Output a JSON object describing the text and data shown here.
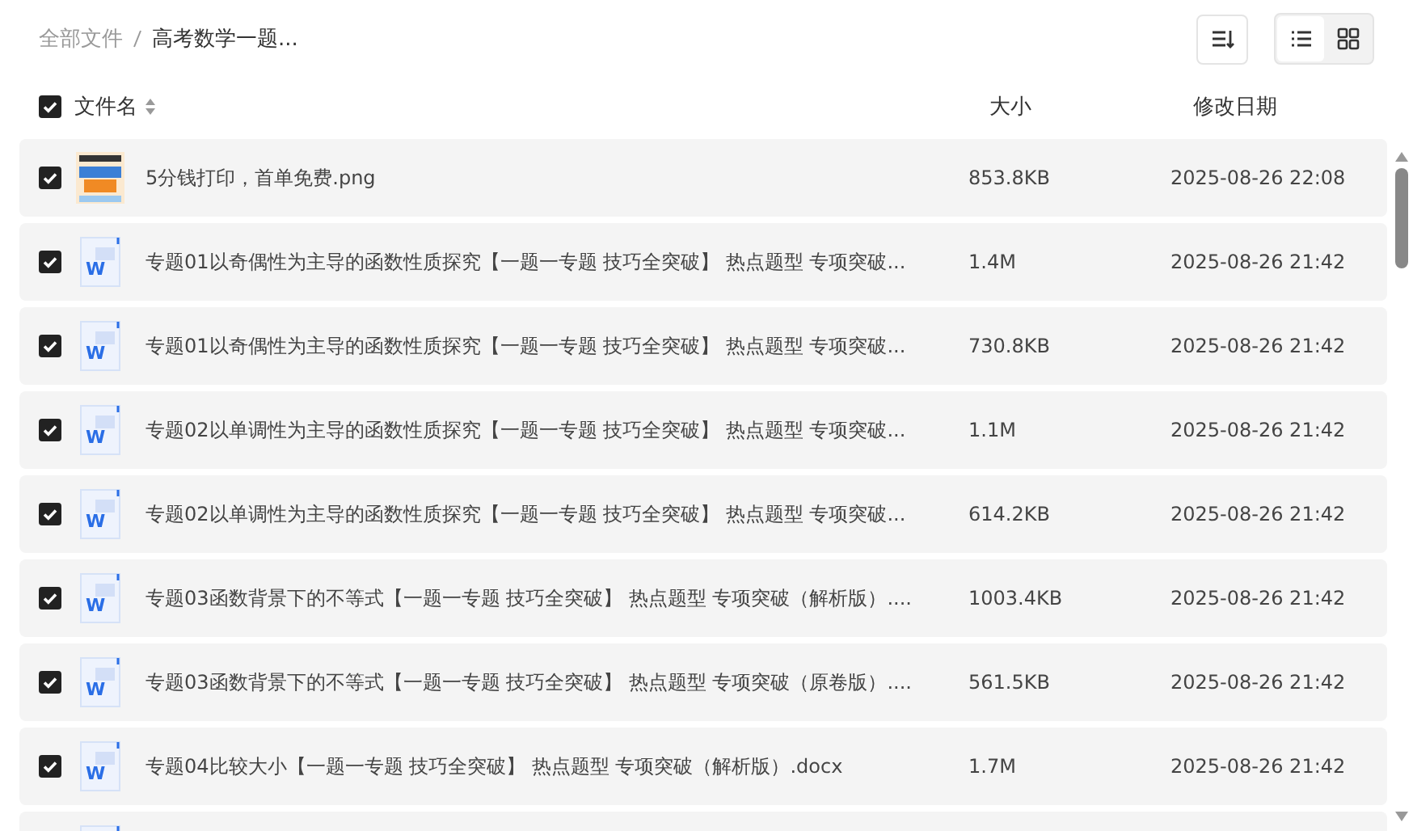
{
  "breadcrumb": [
    {
      "label": "全部文件",
      "current": false
    },
    {
      "label": "高考数学一题...",
      "current": true
    }
  ],
  "view_modes": [
    {
      "kind": "list",
      "selected": true
    },
    {
      "kind": "grid",
      "selected": false
    }
  ],
  "table": {
    "all_checked": true,
    "columns": [
      "文件名",
      "大小",
      "修改日期"
    ],
    "rows": [
      {
        "kind": "image",
        "checked": true,
        "name": "5分钱打印，首单免费.png",
        "size": "853.8KB",
        "modified": "2025-08-26 22:08"
      },
      {
        "kind": "doc",
        "checked": true,
        "icon_letter": "W",
        "name": "专题01以奇偶性为主导的函数性质探究【一题一专题 技巧全突破】 热点题型 专项突破...",
        "size": "1.4M",
        "modified": "2025-08-26 21:42"
      },
      {
        "kind": "doc",
        "checked": true,
        "icon_letter": "W",
        "name": "专题01以奇偶性为主导的函数性质探究【一题一专题 技巧全突破】 热点题型 专项突破...",
        "size": "730.8KB",
        "modified": "2025-08-26 21:42"
      },
      {
        "kind": "doc",
        "checked": true,
        "icon_letter": "W",
        "name": "专题02以单调性为主导的函数性质探究【一题一专题 技巧全突破】 热点题型 专项突破...",
        "size": "1.1M",
        "modified": "2025-08-26 21:42"
      },
      {
        "kind": "doc",
        "checked": true,
        "icon_letter": "W",
        "name": "专题02以单调性为主导的函数性质探究【一题一专题 技巧全突破】 热点题型 专项突破...",
        "size": "614.2KB",
        "modified": "2025-08-26 21:42"
      },
      {
        "kind": "doc",
        "checked": true,
        "icon_letter": "W",
        "name": "专题03函数背景下的不等式【一题一专题 技巧全突破】 热点题型 专项突破（解析版）....",
        "size": "1003.4KB",
        "modified": "2025-08-26 21:42"
      },
      {
        "kind": "doc",
        "checked": true,
        "icon_letter": "W",
        "name": "专题03函数背景下的不等式【一题一专题 技巧全突破】 热点题型 专项突破（原卷版）....",
        "size": "561.5KB",
        "modified": "2025-08-26 21:42"
      },
      {
        "kind": "doc",
        "checked": true,
        "icon_letter": "W",
        "name": "专题04比较大小【一题一专题 技巧全突破】 热点题型 专项突破（解析版）.docx",
        "size": "1.7M",
        "modified": "2025-08-26 21:42"
      },
      {
        "kind": "doc"
      }
    ]
  }
}
